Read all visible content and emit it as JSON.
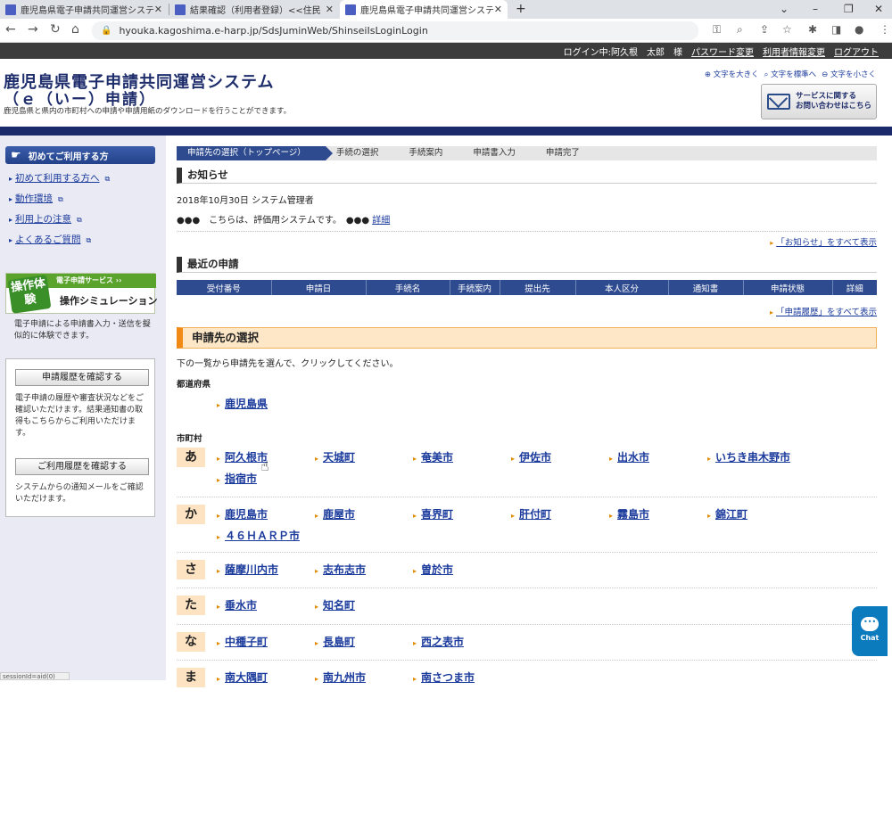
{
  "browser": {
    "tabs": [
      {
        "title": "鹿児島県電子申請共同運営システ"
      },
      {
        "title": "結果確認（利用者登録）<<住民"
      },
      {
        "title": "鹿児島県電子申請共同運営システ"
      }
    ],
    "new_tab": "+",
    "url": "hyouka.kagoshima.e-harp.jp/SdsJuminWeb/ShinseiIsLoginLogin"
  },
  "userbar": {
    "status": "ログイン中:阿久根　太郎　様",
    "password_change": "パスワード変更",
    "user_info_change": "利用者情報変更",
    "logout": "ログアウト"
  },
  "header": {
    "title": "鹿児島県電子申請共同運営システム",
    "subtitle": "（ｅ（いー）申請）",
    "description": "鹿児島県と県内の市町村への申請や申請用紙のダウンロードを行うことができます。",
    "font_larger": "文字を大きく",
    "font_standard": "文字を標準へ",
    "font_smaller": "文字を小さく",
    "contact_line1": "サービスに関する",
    "contact_line2": "お問い合わせはこちら"
  },
  "sidebar": {
    "beginner_title": "初めてご利用する方",
    "links": [
      {
        "label": "初めて利用する方へ"
      },
      {
        "label": "動作環境"
      },
      {
        "label": "利用上の注意"
      },
      {
        "label": "よくあるご質問"
      }
    ],
    "sim_lead": "電子申請サービス ››",
    "sim_badge": "操作体験",
    "sim_title": "操作シミュレーション",
    "sim_text": "電子申請による申請書入力・送信を擬似的に体験できます。",
    "history_button": "申請履歴を確認する",
    "history_text": "電子申請の履歴や審査状況などをご確認いただけます。結果通知書の取得もこちらからご利用いただけます。",
    "usage_button": "ご利用履歴を確認する",
    "usage_text": "システムからの通知メールをご確認いただけます。",
    "status_text": "sessionId=aid(0)"
  },
  "steps": [
    "申請先の選択（トップページ）",
    "手続の選択",
    "手続案内",
    "申請書入力",
    "申請完了"
  ],
  "notice": {
    "title": "お知らせ",
    "date_line": "2018年10月30日 システム管理者",
    "body": "●●●　こちらは、評価用システムです。　●●●",
    "detail": "詳細",
    "see_all": "「お知らせ」をすべて表示"
  },
  "recent": {
    "title": "最近の申請",
    "columns": [
      "受付番号",
      "申請日",
      "手続名",
      "手続案内",
      "提出先",
      "本人区分",
      "通知書",
      "申請状態",
      "詳細"
    ],
    "see_all": "「申請履歴」をすべて表示"
  },
  "select": {
    "title": "申請先の選択",
    "description": "下の一覧から申請先を選んで、クリックしてください。",
    "prefecture_label": "都道府県",
    "prefecture": "鹿児島県",
    "municipality_label": "市町村",
    "rows": [
      {
        "kana": "あ",
        "items": [
          "阿久根市",
          "天城町",
          "奄美市",
          "伊佐市",
          "出水市",
          "いちき串木野市",
          "指宿市"
        ]
      },
      {
        "kana": "か",
        "items": [
          "鹿児島市",
          "鹿屋市",
          "喜界町",
          "肝付町",
          "霧島市",
          "錦江町",
          "４６ＨＡＲＰ市"
        ]
      },
      {
        "kana": "さ",
        "items": [
          "薩摩川内市",
          "志布志市",
          "曽於市"
        ]
      },
      {
        "kana": "た",
        "items": [
          "垂水市",
          "知名町"
        ]
      },
      {
        "kana": "な",
        "items": [
          "中種子町",
          "長島町",
          "西之表市"
        ]
      },
      {
        "kana": "ま",
        "items": [
          "南大隅町",
          "南九州市",
          "南さつま市"
        ]
      }
    ]
  },
  "chat": {
    "label": "Chat"
  }
}
